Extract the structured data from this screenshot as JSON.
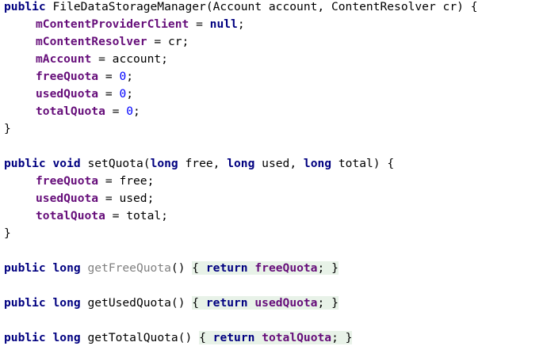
{
  "code": {
    "kw_public": "public",
    "kw_void": "void",
    "kw_long": "long",
    "kw_return": "return",
    "kw_null": "null",
    "constructor_name": "FileDataStorageManager",
    "constructor_params": "(Account account, ContentResolver cr)",
    "brace_open": "{",
    "brace_close": "}",
    "f_provider_client": "mContentProviderClient",
    "f_resolver": "mContentResolver",
    "f_account": "mAccount",
    "f_free": "freeQuota",
    "f_used": "usedQuota",
    "f_total": "totalQuota",
    "assign": " = ",
    "semicolon": ";",
    "zero": "0",
    "v_cr": "cr",
    "v_account": "account",
    "v_free": "free",
    "v_used": "used",
    "v_total": "total",
    "m_set_quota": "setQuota",
    "set_params_1": "(",
    "set_params_2": " free, ",
    "set_params_3": " used, ",
    "set_params_4": " total) ",
    "m_get_free": "getFreeQuota",
    "m_get_used": "getUsedQuota",
    "m_get_total": "getTotalQuota",
    "empty_parens": "()"
  }
}
